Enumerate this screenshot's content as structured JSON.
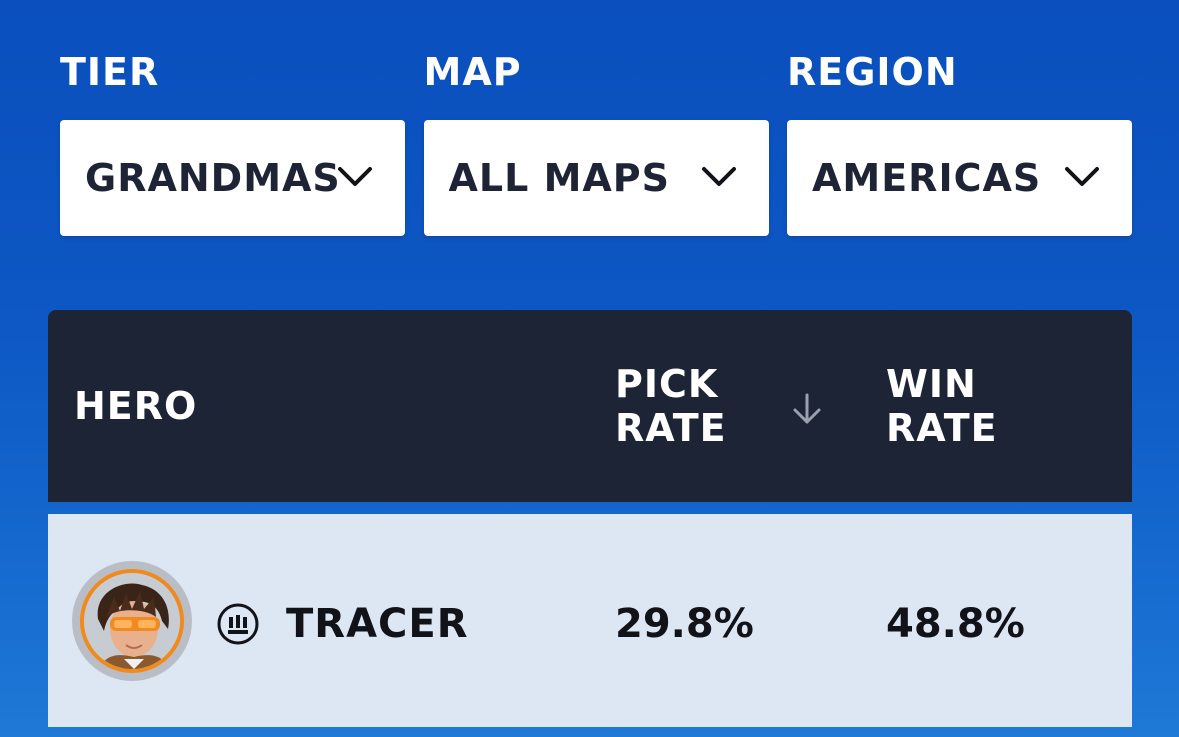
{
  "filters": {
    "tier": {
      "label": "TIER",
      "value": "GRANDMASTER"
    },
    "map": {
      "label": "MAP",
      "value": "ALL MAPS"
    },
    "region": {
      "label": "REGION",
      "value": "AMERICAS"
    }
  },
  "table": {
    "headers": {
      "hero": "HERO",
      "pick_rate_line1": "PICK",
      "pick_rate_line2": "RATE",
      "win_rate_line1": "WIN",
      "win_rate_line2": "RATE"
    },
    "sort_icon": "arrow-down-icon",
    "rows": [
      {
        "hero": "TRACER",
        "role_icon": "damage-role-icon",
        "pick_rate": "29.8%",
        "win_rate": "48.8%"
      }
    ]
  },
  "colors": {
    "background": "#0d58c4",
    "header_bg": "#1d2436",
    "row_bg": "#dde6f3",
    "avatar_ring": "#f08a1c"
  }
}
